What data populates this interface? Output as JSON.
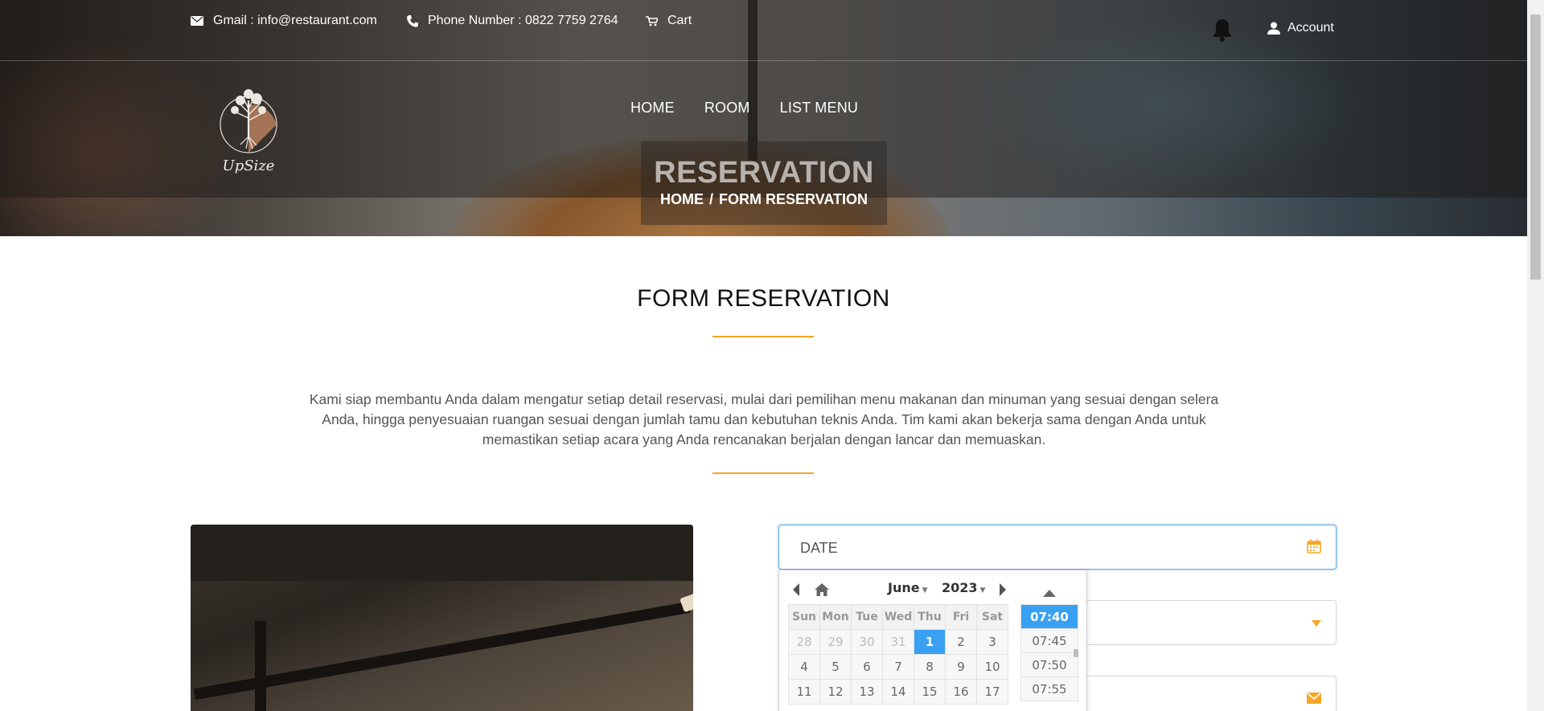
{
  "topbar": {
    "email": "Gmail : info@restaurant.com",
    "phone": "Phone Number : 0822 7759 2764",
    "cart": "Cart",
    "account": "Account"
  },
  "logo": {
    "text": "UpSize"
  },
  "nav": {
    "items": [
      "HOME",
      "ROOM",
      "LIST MENU"
    ]
  },
  "hero": {
    "title": "RESERVATION",
    "breadcrumb": [
      "HOME",
      "/",
      "FORM RESERVATION"
    ]
  },
  "section": {
    "title": "FORM RESERVATION",
    "intro": "Kami siap membantu Anda dalam mengatur setiap detail reservasi, mulai dari pemilihan menu makanan dan minuman yang sesuai dengan selera Anda, hingga penyesuaian ruangan sesuai dengan jumlah tamu dan kebutuhan teknis Anda. Tim kami akan bekerja sama dengan Anda untuk memastikan setiap acara yang Anda rencanakan berjalan dengan lancar dan memuaskan."
  },
  "form": {
    "date_value": "DATE"
  },
  "datepicker": {
    "month": "June",
    "year": "2023",
    "weekdays": [
      "Sun",
      "Mon",
      "Tue",
      "Wed",
      "Thu",
      "Fri",
      "Sat"
    ],
    "weeks": [
      [
        "28",
        "29",
        "30",
        "31",
        "1",
        "2",
        "3"
      ],
      [
        "4",
        "5",
        "6",
        "7",
        "8",
        "9",
        "10"
      ],
      [
        "11",
        "12",
        "13",
        "14",
        "15",
        "16",
        "17"
      ]
    ],
    "selected_day": "1",
    "times": [
      "07:40",
      "07:45",
      "07:50",
      "07:55"
    ],
    "selected_time": "07:40"
  },
  "colors": {
    "accent": "#f5a623",
    "picker_selected": "#3aa0f2",
    "focus_border": "#5aa8e8"
  }
}
